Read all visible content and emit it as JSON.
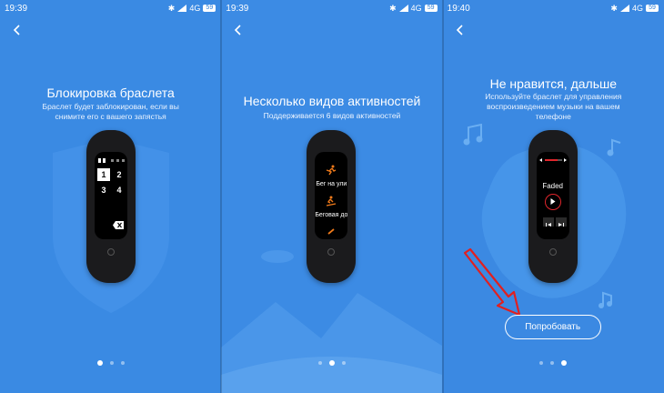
{
  "panels": [
    {
      "status": {
        "time": "19:39",
        "network": "4G",
        "battery": "59"
      },
      "title": "Блокировка браслета",
      "subtitle": "Браслет будет заблокирован, если вы снимите его с вашего запястья",
      "band": {
        "keys": [
          "1",
          "2",
          "3",
          "4"
        ],
        "selected_key": "1"
      }
    },
    {
      "status": {
        "time": "19:39",
        "network": "4G",
        "battery": "59"
      },
      "title": "Несколько видов активностей",
      "subtitle": "Поддерживается 6 видов активностей",
      "band": {
        "activities": [
          "Бег на ули",
          "Беговая до"
        ]
      }
    },
    {
      "status": {
        "time": "19:40",
        "network": "4G",
        "battery": "59"
      },
      "title": "Не нравится, дальше",
      "subtitle": "Используйте браслет для управления воспроизведением музыки на вашем телефоне",
      "band": {
        "track": "Faded"
      },
      "button": "Попробовать"
    }
  ],
  "pagination": {
    "count": 3
  },
  "colors": {
    "background": "#3a8ae3",
    "accent_red": "#e0252b",
    "activity_orange": "#f07a1a",
    "annotation_arrow": "#e02020"
  }
}
